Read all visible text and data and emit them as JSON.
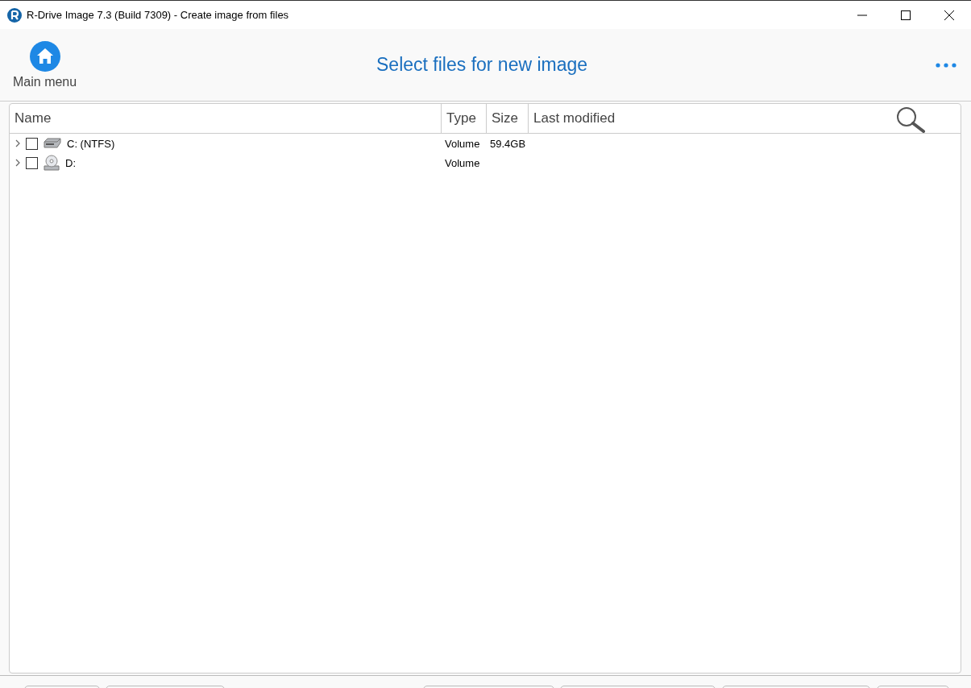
{
  "window": {
    "title": "R-Drive Image 7.3 (Build 7309) - Create image from files"
  },
  "toolbar": {
    "main_menu": "Main menu",
    "heading": "Select files for new image"
  },
  "table": {
    "columns": [
      "Name",
      "Type",
      "Size",
      "Last modified"
    ],
    "rows": [
      {
        "name": "C: (NTFS)",
        "kind": "hdd",
        "checked": false,
        "expanded": false,
        "type": "Volume",
        "size": "59.4GB"
      },
      {
        "name": "D:",
        "kind": "cd",
        "checked": false,
        "expanded": false,
        "type": "Volume",
        "size": ""
      }
    ]
  }
}
